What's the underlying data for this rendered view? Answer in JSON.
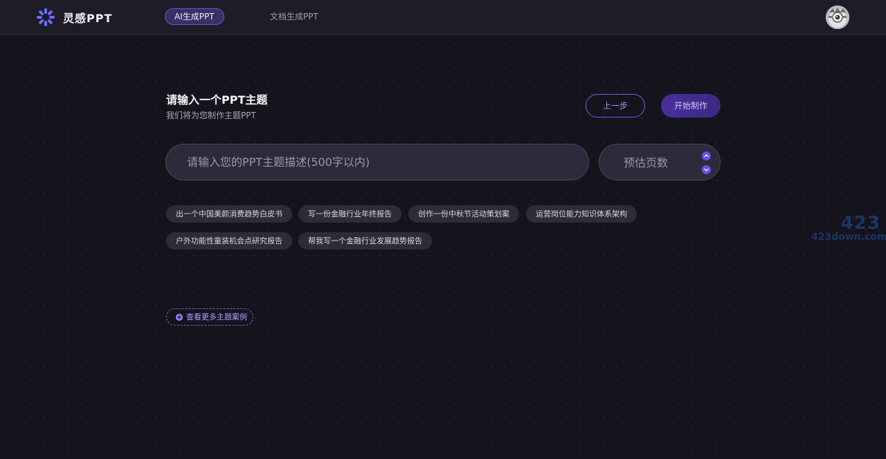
{
  "brand": {
    "name": "灵感PPT",
    "accent_color": "#7a5cf0",
    "logo_icon": "sparkle-burst-icon"
  },
  "nav": {
    "tabs": [
      {
        "label": "AI生成PPT",
        "active": true
      },
      {
        "label": "文档生成PPT",
        "active": false
      }
    ]
  },
  "user": {
    "avatar_icon": "user-avatar-icon"
  },
  "main": {
    "title": "请输入一个PPT主题",
    "subtitle": "我们将为您制作主题PPT",
    "prev_button": "上一步",
    "start_button": "开始制作",
    "topic_input": {
      "value": "",
      "placeholder": "请输入您的PPT主题描述(500字以内)"
    },
    "pages": {
      "placeholder": "预估页数",
      "up_icon": "chevron-up-icon",
      "down_icon": "chevron-down-icon"
    },
    "suggestions": [
      "出一个中国美颜消费趋势白皮书",
      "写一份金融行业年终报告",
      "创作一份中秋节活动策划案",
      "运营岗位能力知识体系架构",
      "户外功能性童装机会点研究报告",
      "帮我写一个金融行业发展趋势报告"
    ],
    "more_cases": "查看更多主题案例"
  },
  "watermark": {
    "big": "423",
    "small": "423down.com"
  }
}
